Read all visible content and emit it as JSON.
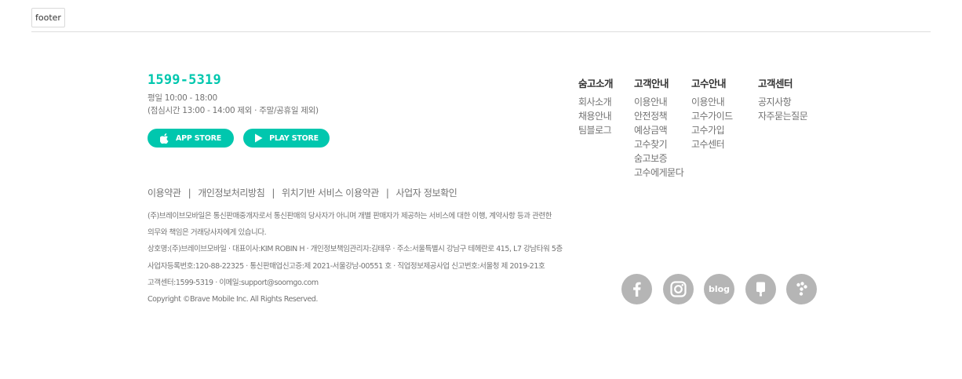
{
  "debug_tag": "footer",
  "contact": {
    "phone": "1599-5319",
    "hours": "평일 10:00 - 18:00",
    "hours_note": "(점심시간 13:00 - 14:00 제외 · 주말/공휴일 제외)"
  },
  "stores": {
    "app_store": "APP STORE",
    "play_store": "PLAY STORE"
  },
  "columns": [
    {
      "title": "숨고소개",
      "items": [
        "회사소개",
        "채용안내",
        "팀블로그"
      ]
    },
    {
      "title": "고객안내",
      "items": [
        "이용안내",
        "안전정책",
        "예상금액",
        "고수찾기",
        "숨고보증",
        "고수에게묻다"
      ]
    },
    {
      "title": "고수안내",
      "items": [
        "이용안내",
        "고수가이드",
        "고수가입",
        "고수센터"
      ]
    },
    {
      "title": "고객센터",
      "items": [
        "공지사항",
        "자주묻는질문"
      ]
    }
  ],
  "policies": [
    "이용약관",
    "개인정보처리방침",
    "위치기반 서비스 이용약관",
    "사업자 정보확인"
  ],
  "policy_separator": "|",
  "legal": {
    "line1": "(주)브레이브모바일은 통신판매중개자로서 통신판매의 당사자가 아니며 개별 판매자가 제공하는 서비스에 대한 이행, 계약사항 등과 관련한",
    "line2": "의무와 책임은 거래당사자에게 있습니다.",
    "line3": "상호명:(주)브레이브모바일 · 대표이사:KIM ROBIN H · 개인정보책임관리자:김태우 · 주소:서울특별시 강남구 테헤란로 415, L7 강남타워 5층",
    "line4": "사업자등록번호:120-88-22325 · 통신판매업신고증:제 2021-서울강남-00551 호 · 직업정보제공사업 신고번호:서울청 제 2019-21호",
    "line5": "고객센터:1599-5319 · 이메일:support@soomgo.com",
    "copyright": "Copyright ©Brave Mobile Inc. All Rights Reserved."
  },
  "social": [
    "facebook-icon",
    "instagram-icon",
    "blog-icon",
    "naver-post-icon",
    "kakao-story-icon"
  ],
  "colors": {
    "accent": "#00c7ae",
    "icon_gray": "#b5b5b5",
    "text": "#737373",
    "heading": "#323232"
  }
}
